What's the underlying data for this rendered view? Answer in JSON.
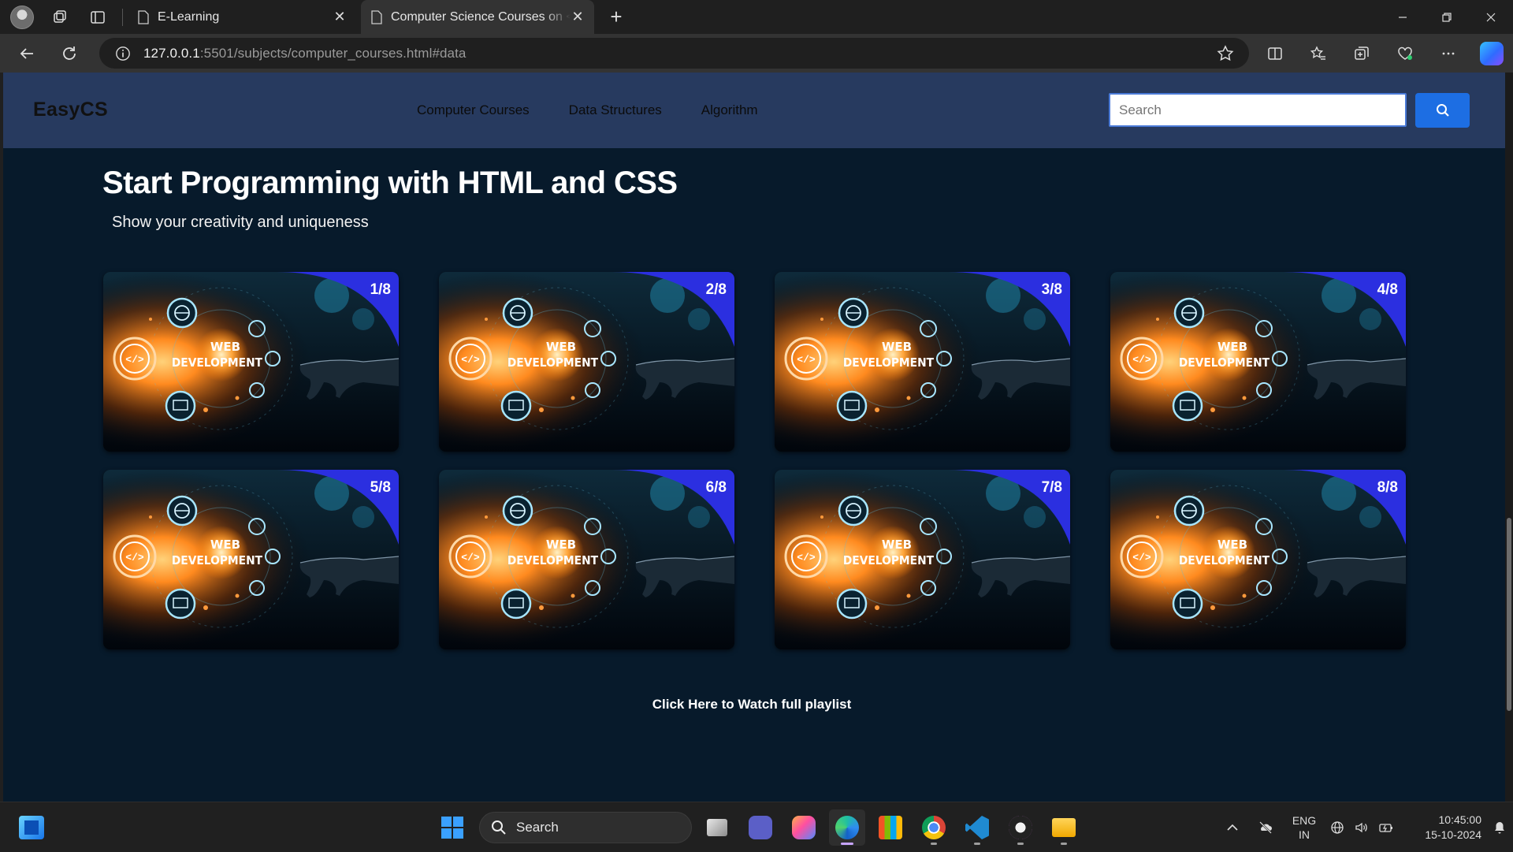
{
  "browser": {
    "tabs": [
      {
        "title": "E-Learning",
        "active": false
      },
      {
        "title": "Computer Science Courses on <h",
        "active": true
      }
    ],
    "url_host": "127.0.0.1",
    "url_rest": ":5501/subjects/computer_courses.html#data"
  },
  "site": {
    "brand": "EasyCS",
    "nav": [
      "Computer Courses",
      "Data Structures",
      "Algorithm"
    ],
    "search_placeholder": "Search",
    "title": "Start Programming with HTML and CSS",
    "subtitle": "Show your creativity and uniqueness",
    "cards": [
      {
        "counter": "1/8"
      },
      {
        "counter": "2/8"
      },
      {
        "counter": "3/8"
      },
      {
        "counter": "4/8"
      },
      {
        "counter": "5/8"
      },
      {
        "counter": "6/8"
      },
      {
        "counter": "7/8"
      },
      {
        "counter": "8/8"
      }
    ],
    "card_art_text_1": "WEB",
    "card_art_text_2": "DEVELOPMENT",
    "playlist_link": "Click Here to Watch full playlist"
  },
  "taskbar": {
    "search_label": "Search",
    "lang_1": "ENG",
    "lang_2": "IN",
    "time": "10:45:00",
    "date": "15-10-2024"
  },
  "colors": {
    "page_bg": "#071a2b",
    "header_bg": "#273a5f",
    "search_button": "#1d6ee3",
    "card_accent": "#2b2fe0"
  }
}
